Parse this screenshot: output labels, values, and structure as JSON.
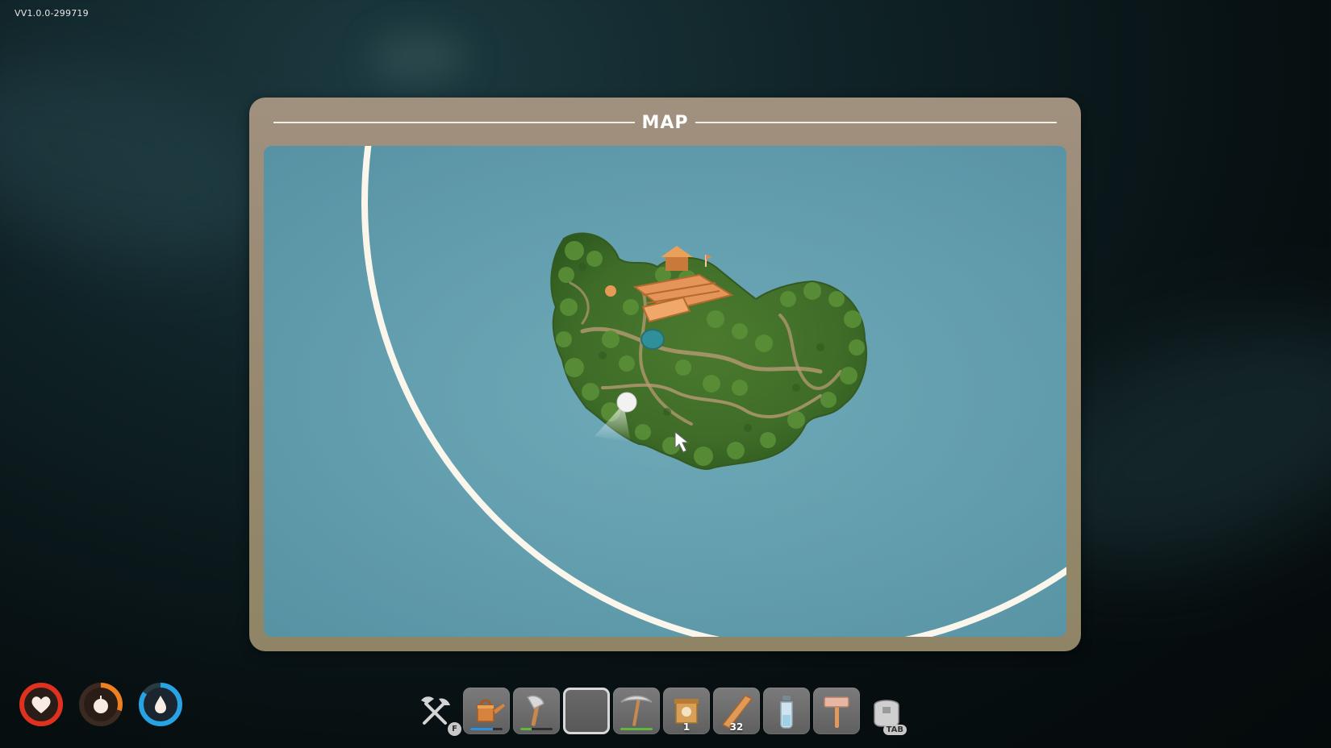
{
  "version": "VV1.0.0-299719",
  "map": {
    "title": "MAP"
  },
  "stats": [
    {
      "name": "health",
      "icon": "heart-icon",
      "color": "#e0311f",
      "value": 1.0
    },
    {
      "name": "hunger",
      "icon": "apple-icon",
      "color": "#f07f22",
      "value": 0.3
    },
    {
      "name": "thirst",
      "icon": "water-drop-icon",
      "color": "#27a2e3",
      "value": 0.85
    }
  ],
  "hotbar": {
    "tools_key": "F",
    "inventory_key": "TAB",
    "slots": [
      {
        "item": "watering-can",
        "icon": "watering-can-icon",
        "count": "",
        "durability": 0.7,
        "bar_color": "#2f8fd8"
      },
      {
        "item": "axe",
        "icon": "axe-icon",
        "count": "",
        "durability": 0.35,
        "bar_color": "#5fb83a"
      },
      {
        "item": "empty",
        "icon": "",
        "count": "",
        "selected": true
      },
      {
        "item": "pickaxe",
        "icon": "pickaxe-icon",
        "count": "",
        "durability": 1.0,
        "bar_color": "#5fb83a"
      },
      {
        "item": "seed-bag",
        "icon": "seed-bag-icon",
        "count": "1"
      },
      {
        "item": "wood-plank",
        "icon": "plank-icon",
        "count": "32"
      },
      {
        "item": "glass-bottle",
        "icon": "bottle-icon",
        "count": ""
      },
      {
        "item": "hammer",
        "icon": "hammer-icon",
        "count": ""
      }
    ]
  }
}
